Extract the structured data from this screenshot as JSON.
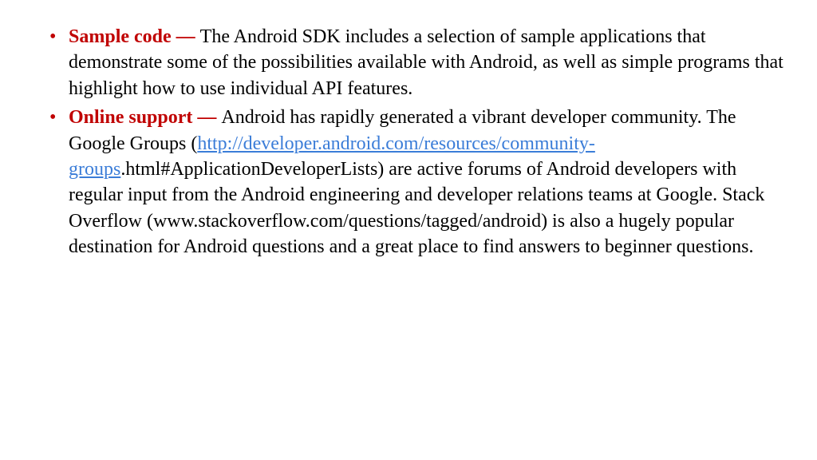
{
  "items": [
    {
      "term": "Sample code — ",
      "body": "The Android SDK includes a selection of sample applications that demonstrate some of the possibilities available with Android, as well as simple programs that highlight how to use individual API features."
    },
    {
      "term": "Online support — ",
      "body_before_link": "Android has rapidly generated a vibrant developer community. The Google Groups (",
      "link_text": "http://developer.android.com/resources/community-groups",
      "body_after_link": ".html#ApplicationDeveloperLists) are active forums of Android developers with regular input from the Android engineering and developer relations teams at Google. Stack Overflow (www.stackoverflow.com/questions/tagged/android) is also a hugely popular destination for Android questions and a great place to find answers to beginner questions."
    }
  ]
}
